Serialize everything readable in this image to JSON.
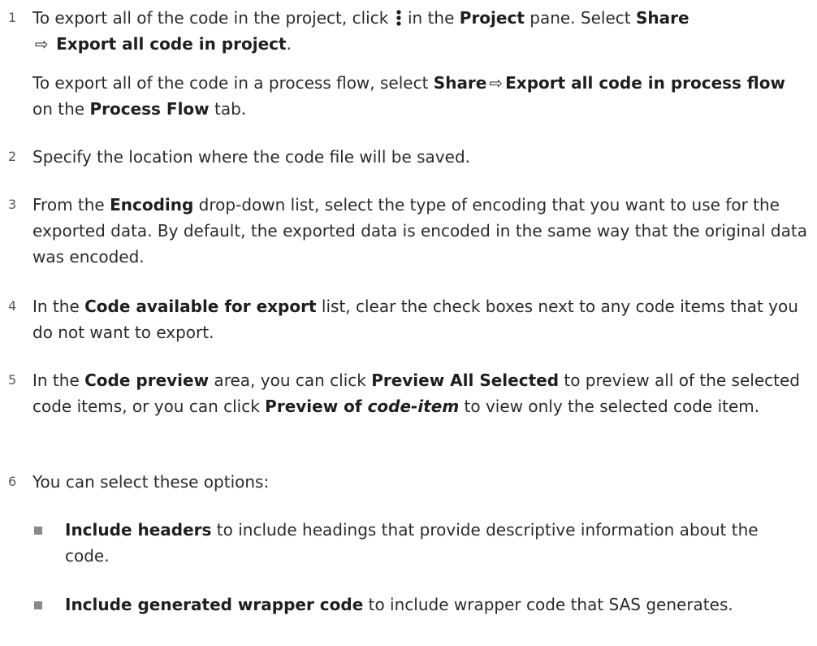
{
  "steps": [
    {
      "num": "1",
      "p1": {
        "pre": "To export all of the code in the project, click ",
        "icon": "vertical-ellipsis-icon",
        "mid1": " in the ",
        "b1": "Project",
        "mid2": " pane. Select ",
        "b2": "Share",
        "arrow": "⇨",
        "b3": "Export all code in project",
        "post": "."
      },
      "p2": {
        "pre": "To export all of the code in a process flow, select ",
        "b1": "Share",
        "arrow": "⇨",
        "b2": "Export all code in process flow",
        "mid": " on the ",
        "b3": "Process Flow",
        "post": " tab."
      }
    },
    {
      "num": "2",
      "text": "Specify the location where the code file will be saved."
    },
    {
      "num": "3",
      "pre": "From the ",
      "b1": "Encoding",
      "post": " drop-down list, select the type of encoding that you want to use for the exported data. By default, the exported data is encoded in the same way that the original data was encoded."
    },
    {
      "num": "4",
      "pre": "In the ",
      "b1": "Code available for export",
      "post": " list, clear the check boxes next to any code items that you do not want to export."
    },
    {
      "num": "5",
      "pre": "In the ",
      "b1": "Code preview",
      "mid1": " area, you can click ",
      "b2": "Preview All Selected",
      "mid2": " to preview all of the selected code items, or you can click ",
      "b3": "Preview of ",
      "b3i": "code-item",
      "post": " to view only the selected code item."
    },
    {
      "num": "6",
      "text": "You can select these options:",
      "bullets": [
        {
          "b": "Include headers",
          "text": " to include headings that provide descriptive information about the code."
        },
        {
          "b": "Include generated wrapper code",
          "text": " to include wrapper code that SAS generates."
        }
      ]
    }
  ]
}
